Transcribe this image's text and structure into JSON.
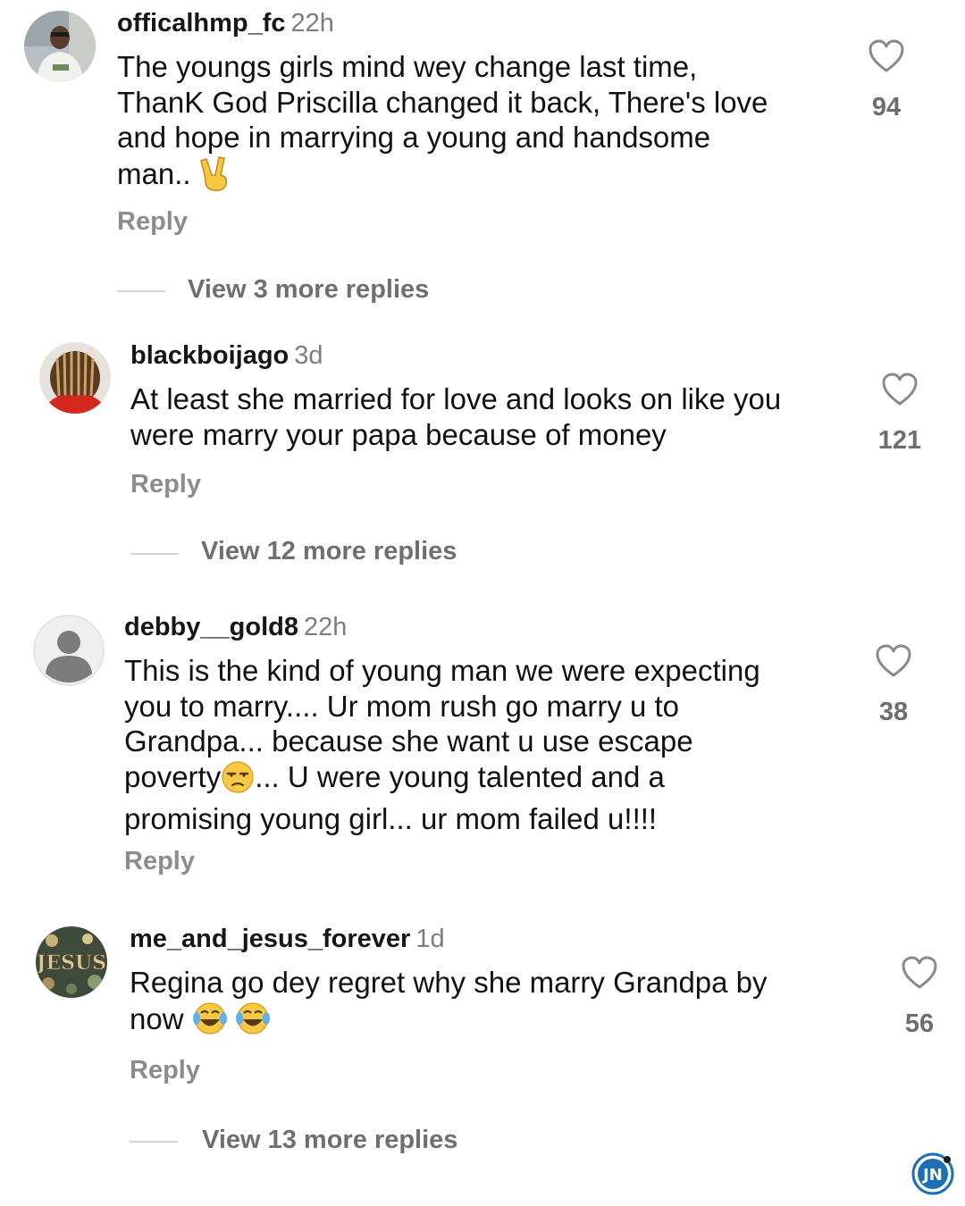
{
  "comments": [
    {
      "username": "officalhmp_fc",
      "time": "22h",
      "text_lines": [
        "The youngs girls mind wey change last time,",
        "ThanK God Priscilla changed it back, There's love",
        "and hope in marrying a young and handsome"
      ],
      "last_line": "man..",
      "last_emoji": "victory-hand-emoji",
      "likes": "94",
      "reply_label": "Reply",
      "view_more": "View 3 more replies"
    },
    {
      "username": "blackboijago",
      "time": "3d",
      "text_lines": [
        "At least she married for love and looks on like you",
        "were marry your papa because of money"
      ],
      "likes": "121",
      "reply_label": "Reply",
      "view_more": "View 12 more replies"
    },
    {
      "username": "debby__gold8",
      "time": "22h",
      "text_lines": [
        "This is the kind of young man we were expecting",
        "you to marry.... Ur mom rush go marry u to",
        "Grandpa... because she want u use escape"
      ],
      "line4_a": "poverty",
      "line4_emoji": "unamused-face-emoji",
      "line4_b": "... U were young talented and a",
      "text_line5": "promising young girl... ur mom failed u!!!!",
      "likes": "38",
      "reply_label": "Reply"
    },
    {
      "username": "me_and_jesus_forever",
      "time": "1d",
      "text_lines": [
        "Regina go dey regret why she marry Grandpa by"
      ],
      "last_line": "now",
      "last_emoji": "tears-of-joy-emoji",
      "avatar_text": "JESUS",
      "likes": "56",
      "reply_label": "Reply",
      "view_more": "View 13 more replies"
    }
  ],
  "watermark": "JN",
  "colors": {
    "username": "#161616",
    "timestamp": "#7d7d7d",
    "muted": "#8c8c8c",
    "heart": "#8a8a8a"
  }
}
